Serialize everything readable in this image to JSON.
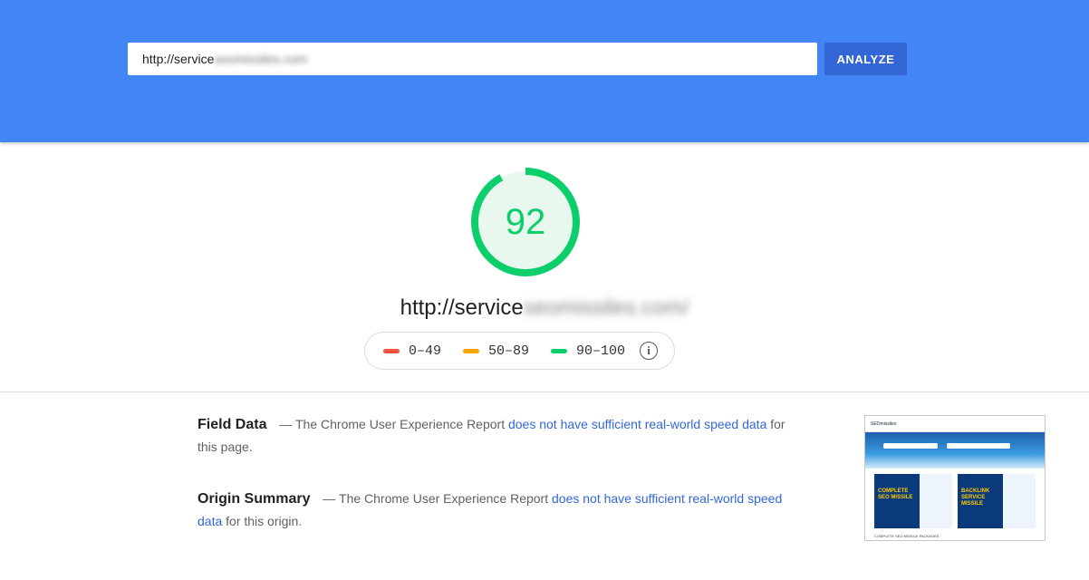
{
  "search": {
    "value_prefix": "http://service",
    "value_hidden": "seomissiles.com",
    "analyze_label": "ANALYZE"
  },
  "score": {
    "value": "92",
    "fraction": 0.92,
    "color": "#0cce6b",
    "track_color": "#e8f8ef"
  },
  "page_url": {
    "prefix": "http://service",
    "hidden": "seomissiles.com/"
  },
  "legend": {
    "items": [
      {
        "label": "0–49",
        "color": "#ff4e42"
      },
      {
        "label": "50–89",
        "color": "#ffa400"
      },
      {
        "label": "90–100",
        "color": "#0cce6b"
      }
    ],
    "info_glyph": "i"
  },
  "field_data": {
    "title": "Field Data",
    "prefix": "— The Chrome User Experience Report ",
    "link": "does not have sufficient real-world speed data",
    "suffix": " for this page."
  },
  "origin_summary": {
    "title": "Origin Summary",
    "prefix": "— The Chrome User Experience Report ",
    "link": "does not have sufficient real-world speed data",
    "suffix": " for this origin."
  },
  "thumbnail": {
    "logo": "SEOmissiles",
    "card1": "COMPLETE SEO MISSILE",
    "card2": "BACKLINK SERVICE MISSILE",
    "footer": "COMPLETE SEO MISSILE PACKAGES"
  },
  "colors": {
    "header_bg": "#4285f4",
    "button_bg": "#3367d6",
    "link": "#3367d6"
  }
}
